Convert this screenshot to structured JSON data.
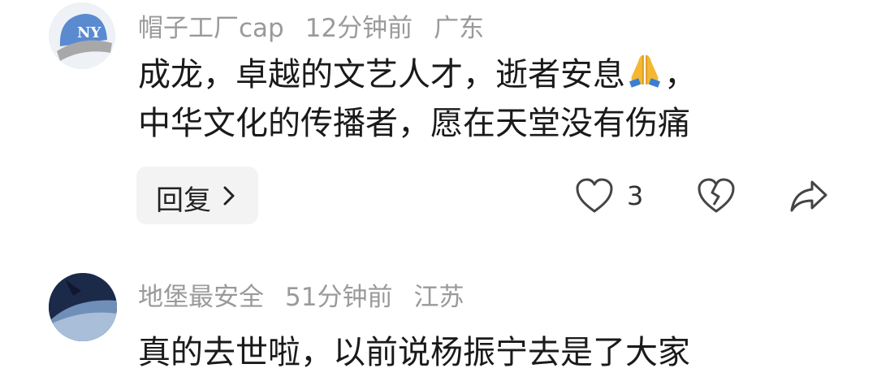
{
  "comments": [
    {
      "username": "帽子工厂cap",
      "time": "12分钟前",
      "location": "广东",
      "text_line1": "成龙，卓越的文艺人才，逝者安息",
      "text_line1_tail": "，",
      "emoji": "folded-hands",
      "text_line2": "中华文化的传播者，愿在天堂没有伤痛",
      "reply_label": "回复",
      "likes": "3"
    },
    {
      "username": "地堡最安全",
      "time": "51分钟前",
      "location": "江苏",
      "text_line1": "真的去世啦，以前说杨振宁去是了大家"
    }
  ],
  "icons": {
    "like": "heart-icon",
    "dislike": "broken-heart-icon",
    "share": "share-arrow-icon",
    "reply_arrow": "chevron-right-icon"
  },
  "colors": {
    "meta_text": "#9a9a9a",
    "body_text": "#1a1a1a",
    "reply_bg": "#f3f3f3",
    "avatar_cap": "#5a8ad0"
  }
}
